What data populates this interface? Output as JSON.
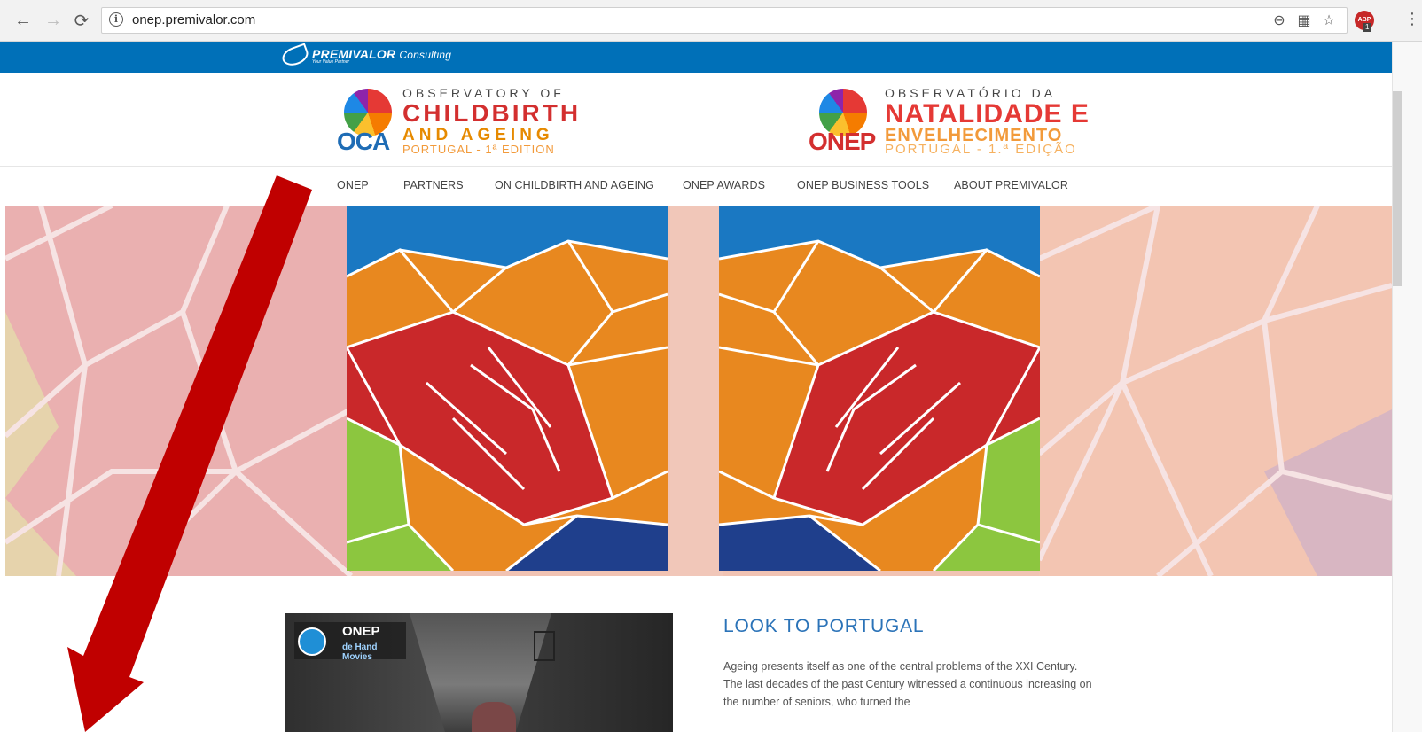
{
  "browser": {
    "url": "onep.premivalor.com",
    "abp_label": "ABP",
    "abp_count": "1"
  },
  "brand": {
    "name": "PREMIVALOR",
    "suffix": "Consulting",
    "tagline": "Your Value Partner"
  },
  "logos": {
    "oca": {
      "line1": "OBSERVATORY OF",
      "line2": "CHILDBIRTH",
      "line3": "AND AGEING",
      "acronym": "OCA",
      "edition": "PORTUGAL - 1ª EDITION"
    },
    "onep": {
      "line1": "OBSERVATÓRIO DA",
      "line2": "NATALIDADE E",
      "line3": "ENVELHECIMENTO",
      "acronym": "ONEP",
      "edition": "PORTUGAL - 1.ª EDIÇÃO"
    }
  },
  "nav": {
    "items": [
      {
        "label": "ONEP"
      },
      {
        "label": "PARTNERS"
      },
      {
        "label": "ON CHILDBIRTH AND AGEING"
      },
      {
        "label": "ONEP AWARDS"
      },
      {
        "label": "ONEP BUSINESS TOOLS"
      },
      {
        "label": "ABOUT PREMIVALOR"
      }
    ]
  },
  "video": {
    "title": "ONEP",
    "subtitle": "de Hand Movies"
  },
  "article": {
    "title": "LOOK TO PORTUGAL",
    "body": "Ageing presents itself as one of the central problems of the XXI Century. The last decades of the past Century witnessed a continuous increasing on the number of seniors, who turned the"
  },
  "colors": {
    "brand_blue": "#0070b8",
    "title_blue": "#2b73b8",
    "arrow_red": "#c00000"
  }
}
